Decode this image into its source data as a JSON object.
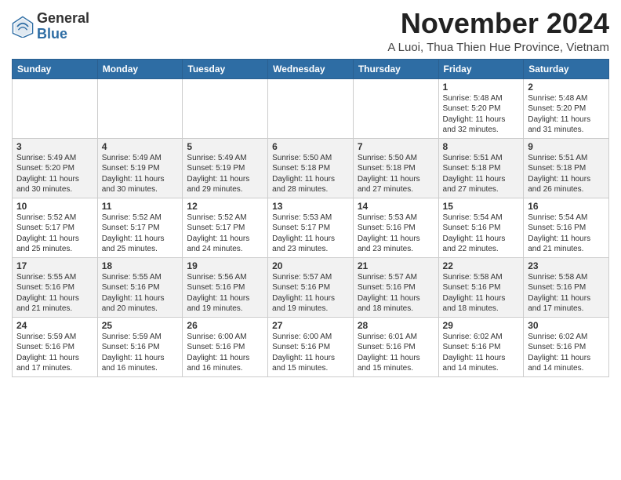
{
  "header": {
    "logo_general": "General",
    "logo_blue": "Blue",
    "month_title": "November 2024",
    "location": "A Luoi, Thua Thien Hue Province, Vietnam"
  },
  "weekdays": [
    "Sunday",
    "Monday",
    "Tuesday",
    "Wednesday",
    "Thursday",
    "Friday",
    "Saturday"
  ],
  "weeks": [
    [
      {
        "day": "",
        "info": ""
      },
      {
        "day": "",
        "info": ""
      },
      {
        "day": "",
        "info": ""
      },
      {
        "day": "",
        "info": ""
      },
      {
        "day": "",
        "info": ""
      },
      {
        "day": "1",
        "info": "Sunrise: 5:48 AM\nSunset: 5:20 PM\nDaylight: 11 hours and 32 minutes."
      },
      {
        "day": "2",
        "info": "Sunrise: 5:48 AM\nSunset: 5:20 PM\nDaylight: 11 hours and 31 minutes."
      }
    ],
    [
      {
        "day": "3",
        "info": "Sunrise: 5:49 AM\nSunset: 5:20 PM\nDaylight: 11 hours and 30 minutes."
      },
      {
        "day": "4",
        "info": "Sunrise: 5:49 AM\nSunset: 5:19 PM\nDaylight: 11 hours and 30 minutes."
      },
      {
        "day": "5",
        "info": "Sunrise: 5:49 AM\nSunset: 5:19 PM\nDaylight: 11 hours and 29 minutes."
      },
      {
        "day": "6",
        "info": "Sunrise: 5:50 AM\nSunset: 5:18 PM\nDaylight: 11 hours and 28 minutes."
      },
      {
        "day": "7",
        "info": "Sunrise: 5:50 AM\nSunset: 5:18 PM\nDaylight: 11 hours and 27 minutes."
      },
      {
        "day": "8",
        "info": "Sunrise: 5:51 AM\nSunset: 5:18 PM\nDaylight: 11 hours and 27 minutes."
      },
      {
        "day": "9",
        "info": "Sunrise: 5:51 AM\nSunset: 5:18 PM\nDaylight: 11 hours and 26 minutes."
      }
    ],
    [
      {
        "day": "10",
        "info": "Sunrise: 5:52 AM\nSunset: 5:17 PM\nDaylight: 11 hours and 25 minutes."
      },
      {
        "day": "11",
        "info": "Sunrise: 5:52 AM\nSunset: 5:17 PM\nDaylight: 11 hours and 25 minutes."
      },
      {
        "day": "12",
        "info": "Sunrise: 5:52 AM\nSunset: 5:17 PM\nDaylight: 11 hours and 24 minutes."
      },
      {
        "day": "13",
        "info": "Sunrise: 5:53 AM\nSunset: 5:17 PM\nDaylight: 11 hours and 23 minutes."
      },
      {
        "day": "14",
        "info": "Sunrise: 5:53 AM\nSunset: 5:16 PM\nDaylight: 11 hours and 23 minutes."
      },
      {
        "day": "15",
        "info": "Sunrise: 5:54 AM\nSunset: 5:16 PM\nDaylight: 11 hours and 22 minutes."
      },
      {
        "day": "16",
        "info": "Sunrise: 5:54 AM\nSunset: 5:16 PM\nDaylight: 11 hours and 21 minutes."
      }
    ],
    [
      {
        "day": "17",
        "info": "Sunrise: 5:55 AM\nSunset: 5:16 PM\nDaylight: 11 hours and 21 minutes."
      },
      {
        "day": "18",
        "info": "Sunrise: 5:55 AM\nSunset: 5:16 PM\nDaylight: 11 hours and 20 minutes."
      },
      {
        "day": "19",
        "info": "Sunrise: 5:56 AM\nSunset: 5:16 PM\nDaylight: 11 hours and 19 minutes."
      },
      {
        "day": "20",
        "info": "Sunrise: 5:57 AM\nSunset: 5:16 PM\nDaylight: 11 hours and 19 minutes."
      },
      {
        "day": "21",
        "info": "Sunrise: 5:57 AM\nSunset: 5:16 PM\nDaylight: 11 hours and 18 minutes."
      },
      {
        "day": "22",
        "info": "Sunrise: 5:58 AM\nSunset: 5:16 PM\nDaylight: 11 hours and 18 minutes."
      },
      {
        "day": "23",
        "info": "Sunrise: 5:58 AM\nSunset: 5:16 PM\nDaylight: 11 hours and 17 minutes."
      }
    ],
    [
      {
        "day": "24",
        "info": "Sunrise: 5:59 AM\nSunset: 5:16 PM\nDaylight: 11 hours and 17 minutes."
      },
      {
        "day": "25",
        "info": "Sunrise: 5:59 AM\nSunset: 5:16 PM\nDaylight: 11 hours and 16 minutes."
      },
      {
        "day": "26",
        "info": "Sunrise: 6:00 AM\nSunset: 5:16 PM\nDaylight: 11 hours and 16 minutes."
      },
      {
        "day": "27",
        "info": "Sunrise: 6:00 AM\nSunset: 5:16 PM\nDaylight: 11 hours and 15 minutes."
      },
      {
        "day": "28",
        "info": "Sunrise: 6:01 AM\nSunset: 5:16 PM\nDaylight: 11 hours and 15 minutes."
      },
      {
        "day": "29",
        "info": "Sunrise: 6:02 AM\nSunset: 5:16 PM\nDaylight: 11 hours and 14 minutes."
      },
      {
        "day": "30",
        "info": "Sunrise: 6:02 AM\nSunset: 5:16 PM\nDaylight: 11 hours and 14 minutes."
      }
    ]
  ]
}
